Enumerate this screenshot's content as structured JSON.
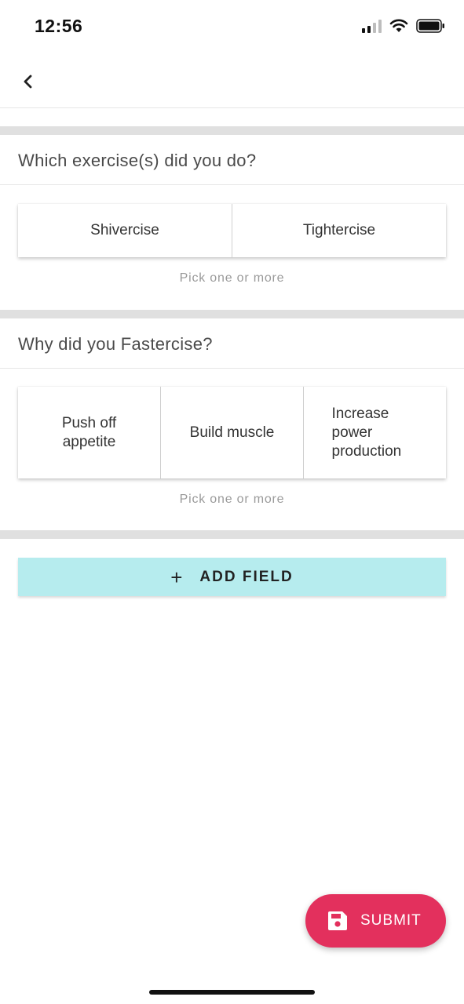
{
  "status_bar": {
    "time": "12:56",
    "icons": [
      "cellular-signal-icon",
      "wifi-icon",
      "battery-icon"
    ]
  },
  "nav": {
    "back_icon": "chevron-left-icon"
  },
  "questions": [
    {
      "title": "Which exercise(s) did you do?",
      "options": [
        "Shivercise",
        "Tightercise"
      ],
      "hint": "Pick one or more"
    },
    {
      "title": "Why did you Fastercise?",
      "options": [
        "Push off appetite",
        "Build muscle",
        "Increase power production"
      ],
      "hint": "Pick one or more"
    }
  ],
  "add_field": {
    "icon": "plus-icon",
    "label": "ADD FIELD",
    "color": "#b6ecee"
  },
  "submit": {
    "icon": "save-icon",
    "label": "SUBMIT",
    "color": "#e3305d"
  }
}
